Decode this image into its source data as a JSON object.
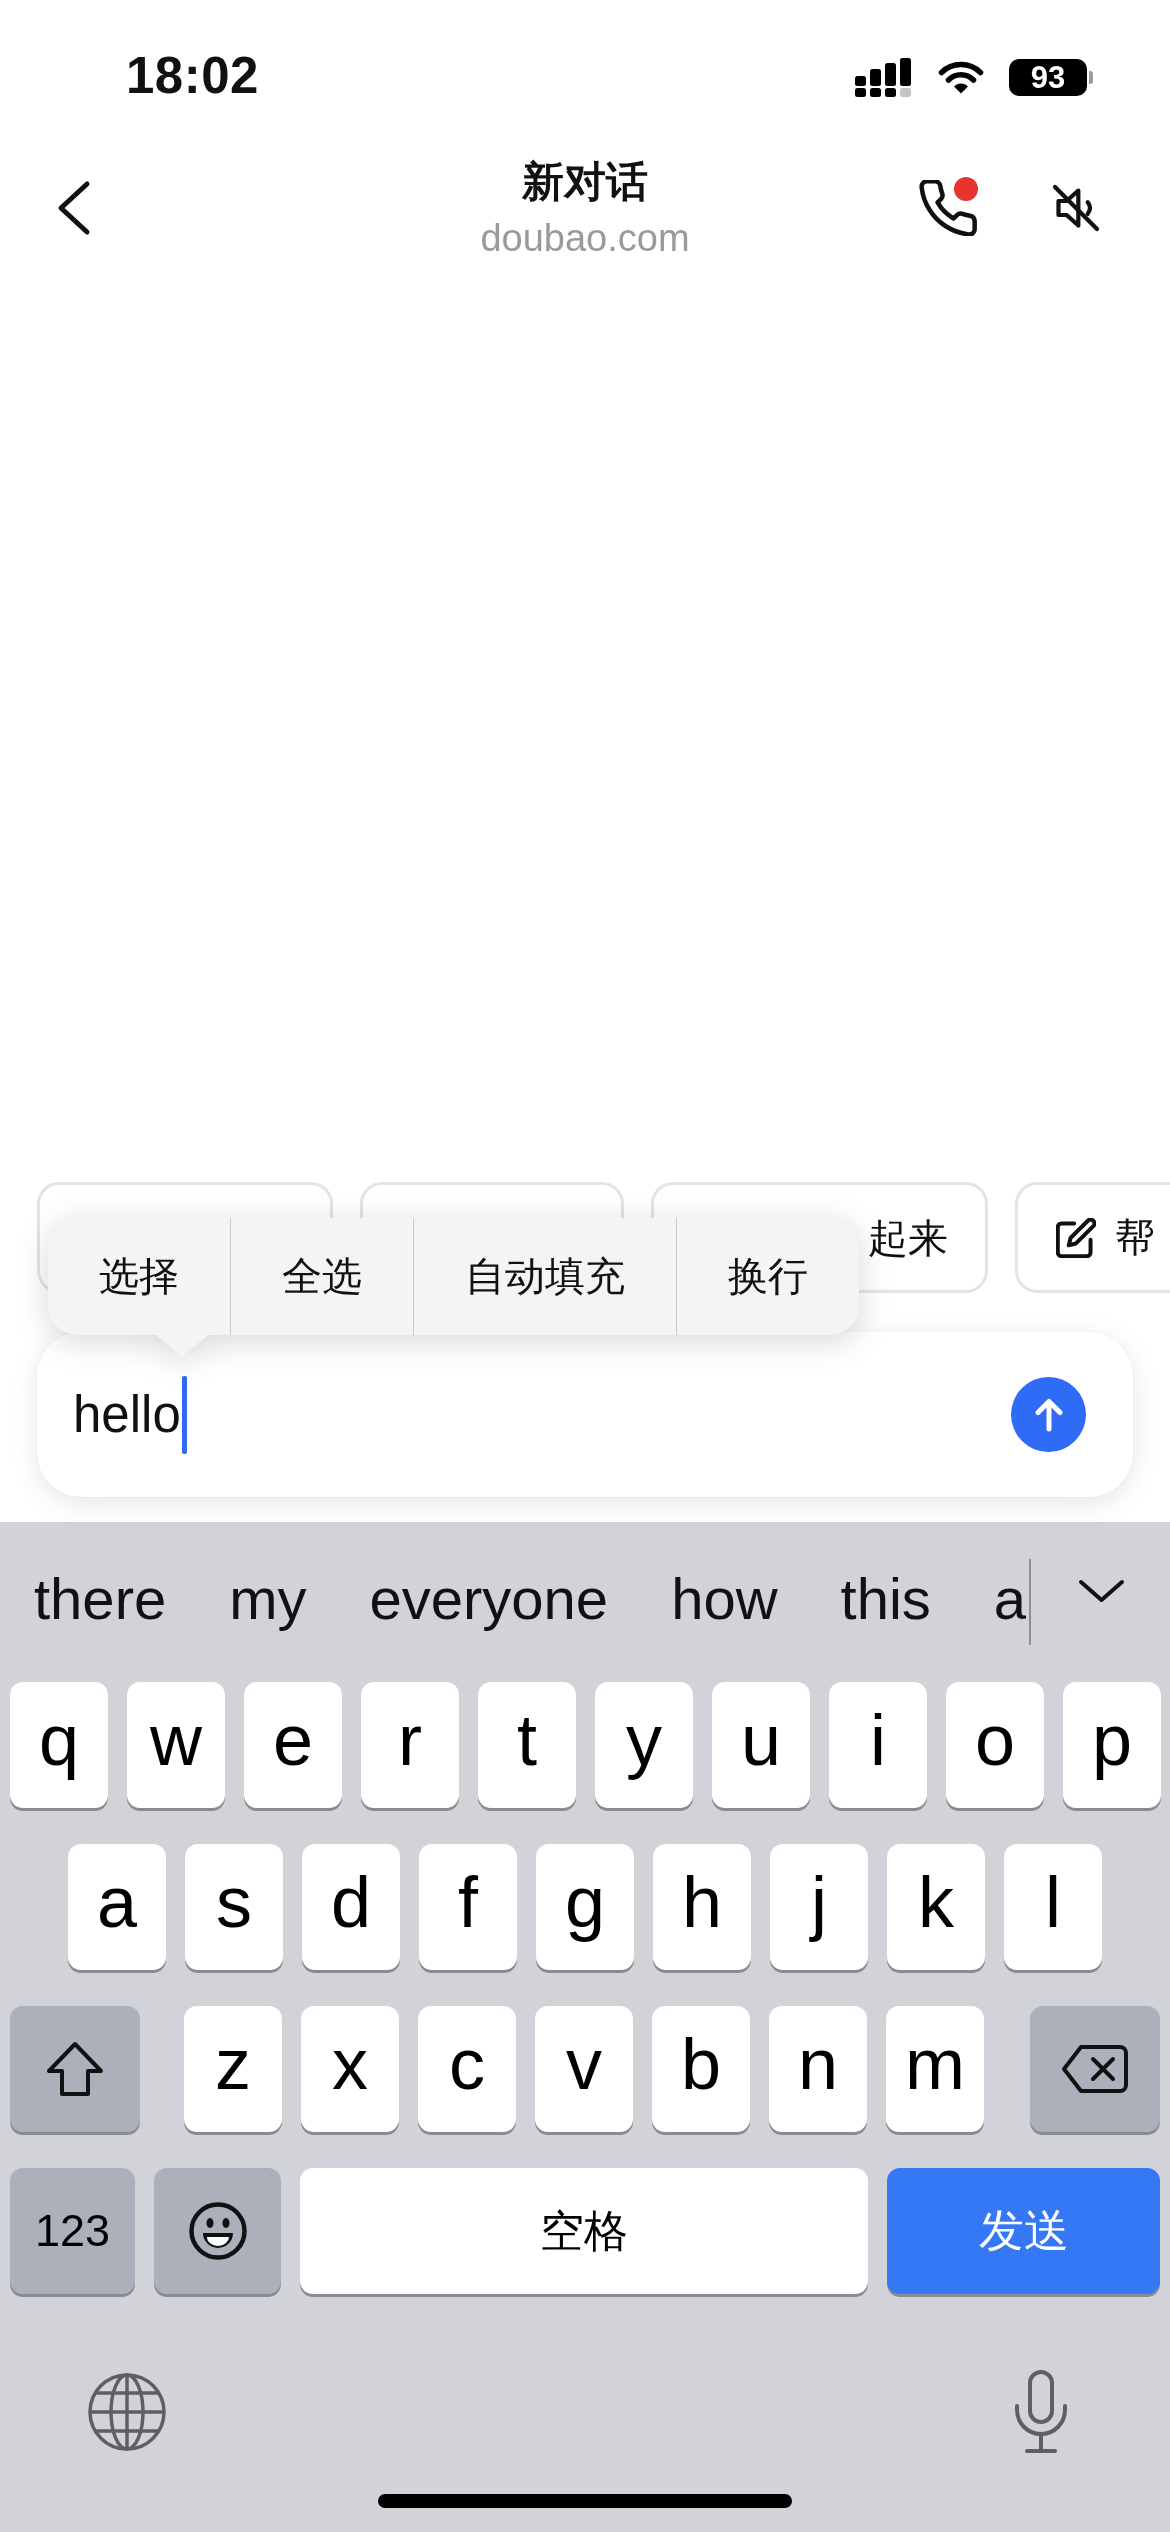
{
  "status_bar": {
    "time": "18:02",
    "battery": "93"
  },
  "header": {
    "title": "新对话",
    "subtitle": "doubao.com",
    "call_badge": true
  },
  "chips": [
    {
      "kind": "covered"
    },
    {
      "kind": "covered"
    },
    {
      "kind": "text",
      "label": "起来"
    },
    {
      "kind": "edit",
      "label": "帮"
    }
  ],
  "context_menu": {
    "items": [
      "选择",
      "全选",
      "自动填充",
      "换行"
    ]
  },
  "composer": {
    "value": "hello"
  },
  "keyboard": {
    "suggestions": [
      "there",
      "my",
      "everyone",
      "how",
      "this",
      "a"
    ],
    "top_row": [
      {
        "kind": "letter",
        "label": "q"
      },
      {
        "kind": "letter",
        "label": "w"
      },
      {
        "kind": "letter",
        "label": "e"
      },
      {
        "kind": "letter",
        "label": "r"
      },
      {
        "kind": "letter",
        "label": "t"
      },
      {
        "kind": "letter",
        "label": "y"
      },
      {
        "kind": "letter",
        "label": "u"
      },
      {
        "kind": "letter",
        "label": "i"
      },
      {
        "kind": "letter",
        "label": "o"
      },
      {
        "kind": "letter",
        "label": "p"
      }
    ],
    "middle_row": [
      {
        "kind": "letter",
        "label": "a"
      },
      {
        "kind": "letter",
        "label": "s"
      },
      {
        "kind": "letter",
        "label": "d"
      },
      {
        "kind": "letter",
        "label": "f"
      },
      {
        "kind": "letter",
        "label": "g"
      },
      {
        "kind": "letter",
        "label": "h"
      },
      {
        "kind": "letter",
        "label": "j"
      },
      {
        "kind": "letter",
        "label": "k"
      },
      {
        "kind": "letter",
        "label": "l"
      }
    ],
    "third_row": [
      {
        "kind": "shift"
      },
      {
        "kind": "letter",
        "label": "z"
      },
      {
        "kind": "letter",
        "label": "x"
      },
      {
        "kind": "letter",
        "label": "c"
      },
      {
        "kind": "letter",
        "label": "v"
      },
      {
        "kind": "letter",
        "label": "b"
      },
      {
        "kind": "letter",
        "label": "n"
      },
      {
        "kind": "letter",
        "label": "m"
      },
      {
        "kind": "delete"
      }
    ],
    "bottom_row": [
      {
        "kind": "numbers",
        "label": "123"
      },
      {
        "kind": "emoji"
      },
      {
        "kind": "space",
        "label": "空格"
      },
      {
        "kind": "send",
        "label": "发送"
      }
    ]
  }
}
